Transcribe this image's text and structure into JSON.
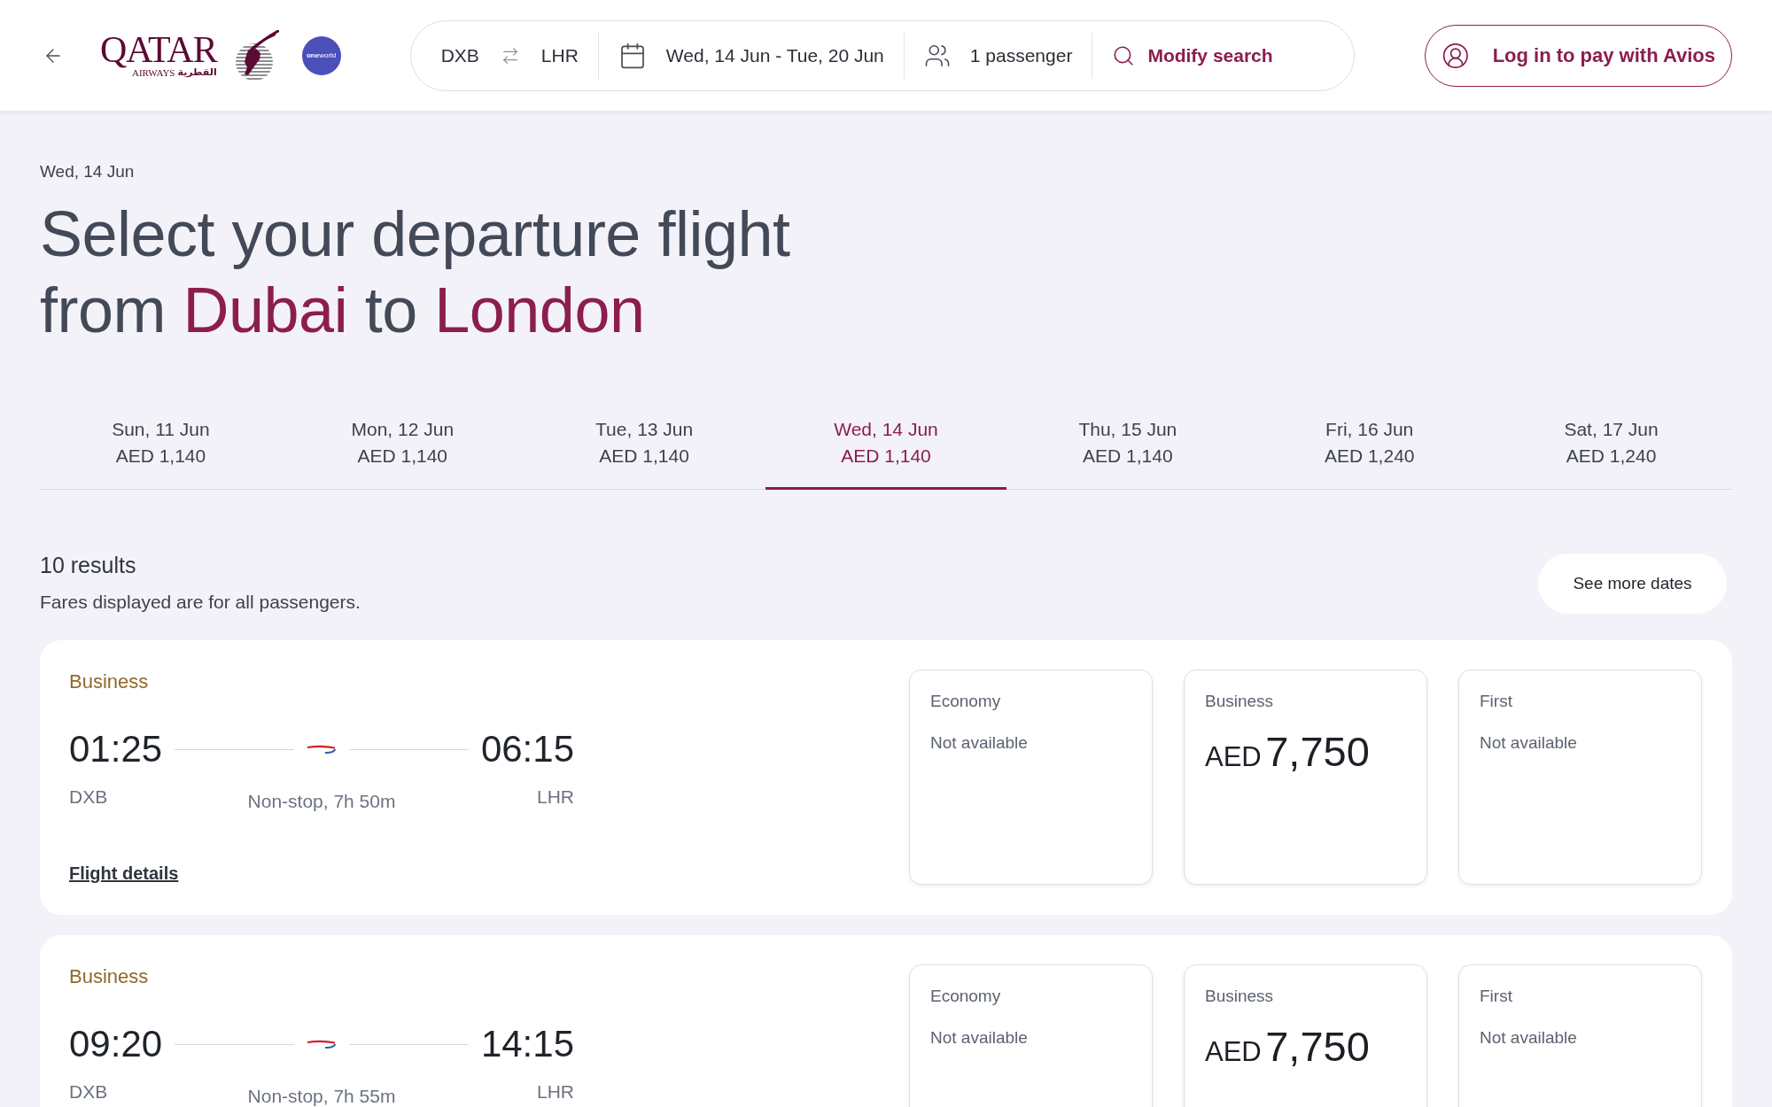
{
  "header": {
    "logo": {
      "wordmark": "QATAR",
      "subtitle": "AIRWAYS",
      "arabic_name": "القطرية"
    },
    "alliance_badge": "**one**world",
    "search_summary": {
      "origin": "DXB",
      "destination": "LHR",
      "dates": "Wed, 14 Jun - Tue, 20 Jun",
      "passengers": "1 passenger",
      "modify_button": "Modify search"
    },
    "login_button": "Log in to pay with Avios"
  },
  "heading": {
    "date": "Wed, 14 Jun",
    "title_lines": [
      [
        {
          "text": "Select your departure flight",
          "highlight": false
        }
      ],
      [
        {
          "text": "from ",
          "highlight": false
        },
        {
          "text": "Dubai",
          "highlight": true
        },
        {
          "text": " to ",
          "highlight": false
        },
        {
          "text": "London",
          "highlight": true
        }
      ]
    ]
  },
  "date_tabs": [
    {
      "date": "Sun, 11 Jun",
      "price": "AED 1,140",
      "selected": false
    },
    {
      "date": "Mon, 12 Jun",
      "price": "AED 1,140",
      "selected": false
    },
    {
      "date": "Tue, 13 Jun",
      "price": "AED 1,140",
      "selected": false
    },
    {
      "date": "Wed, 14 Jun",
      "price": "AED 1,140",
      "selected": true
    },
    {
      "date": "Thu, 15 Jun",
      "price": "AED 1,140",
      "selected": false
    },
    {
      "date": "Fri, 16 Jun",
      "price": "AED 1,240",
      "selected": false
    },
    {
      "date": "Sat, 17 Jun",
      "price": "AED 1,240",
      "selected": false
    }
  ],
  "results": {
    "count": "10 results",
    "note": "Fares displayed are for all passengers.",
    "see_more_button": "See more dates"
  },
  "flights": [
    {
      "cabin_label": "Business",
      "departure_time": "01:25",
      "departure_airport": "DXB",
      "arrival_time": "06:15",
      "arrival_airport": "LHR",
      "duration": "Non-stop, 7h 50m",
      "details_link": "Flight details",
      "fares": [
        {
          "kind": "unavailable",
          "cabin": "Economy",
          "status": "Not available"
        },
        {
          "kind": "price",
          "cabin": "Business",
          "currency": "AED",
          "amount": "7,750"
        },
        {
          "kind": "unavailable",
          "cabin": "First",
          "status": "Not available"
        }
      ]
    },
    {
      "cabin_label": "Business",
      "departure_time": "09:20",
      "departure_airport": "DXB",
      "arrival_time": "14:15",
      "arrival_airport": "LHR",
      "duration": "Non-stop, 7h 55m",
      "fares": [
        {
          "kind": "unavailable",
          "cabin": "Economy",
          "status": "Not available"
        },
        {
          "kind": "price",
          "cabin": "Business",
          "currency": "AED",
          "amount": "7,750"
        },
        {
          "kind": "unavailable",
          "cabin": "First",
          "status": "Not available"
        }
      ]
    }
  ]
}
